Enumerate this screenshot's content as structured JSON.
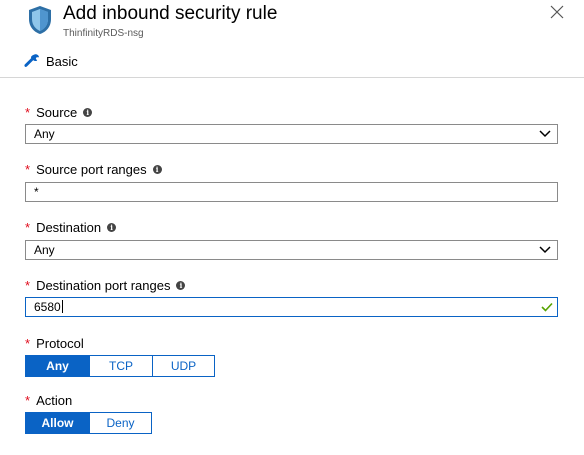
{
  "header": {
    "title": "Add inbound security rule",
    "subtitle": "ThinfinityRDS-nsg",
    "icon": "shield-icon",
    "close_icon": "close-icon"
  },
  "mode": {
    "label": "Basic",
    "icon": "wrench-icon"
  },
  "required_marker": "*",
  "info_glyph": "i",
  "fields": {
    "source": {
      "label": "Source",
      "value": "Any"
    },
    "source_ports": {
      "label": "Source port ranges",
      "value": "*"
    },
    "destination": {
      "label": "Destination",
      "value": "Any"
    },
    "destination_ports": {
      "label": "Destination port ranges",
      "value": "6580",
      "valid": true
    },
    "protocol": {
      "label": "Protocol",
      "options": [
        "Any",
        "TCP",
        "UDP"
      ],
      "selected": "Any"
    },
    "action": {
      "label": "Action",
      "options": [
        "Allow",
        "Deny"
      ],
      "selected": "Allow"
    }
  },
  "colors": {
    "accent": "#0a63c5",
    "required": "#e00b1c",
    "valid_check": "#57a300",
    "shield_dark": "#2d6fa6",
    "shield_light": "#8fc6ea"
  }
}
